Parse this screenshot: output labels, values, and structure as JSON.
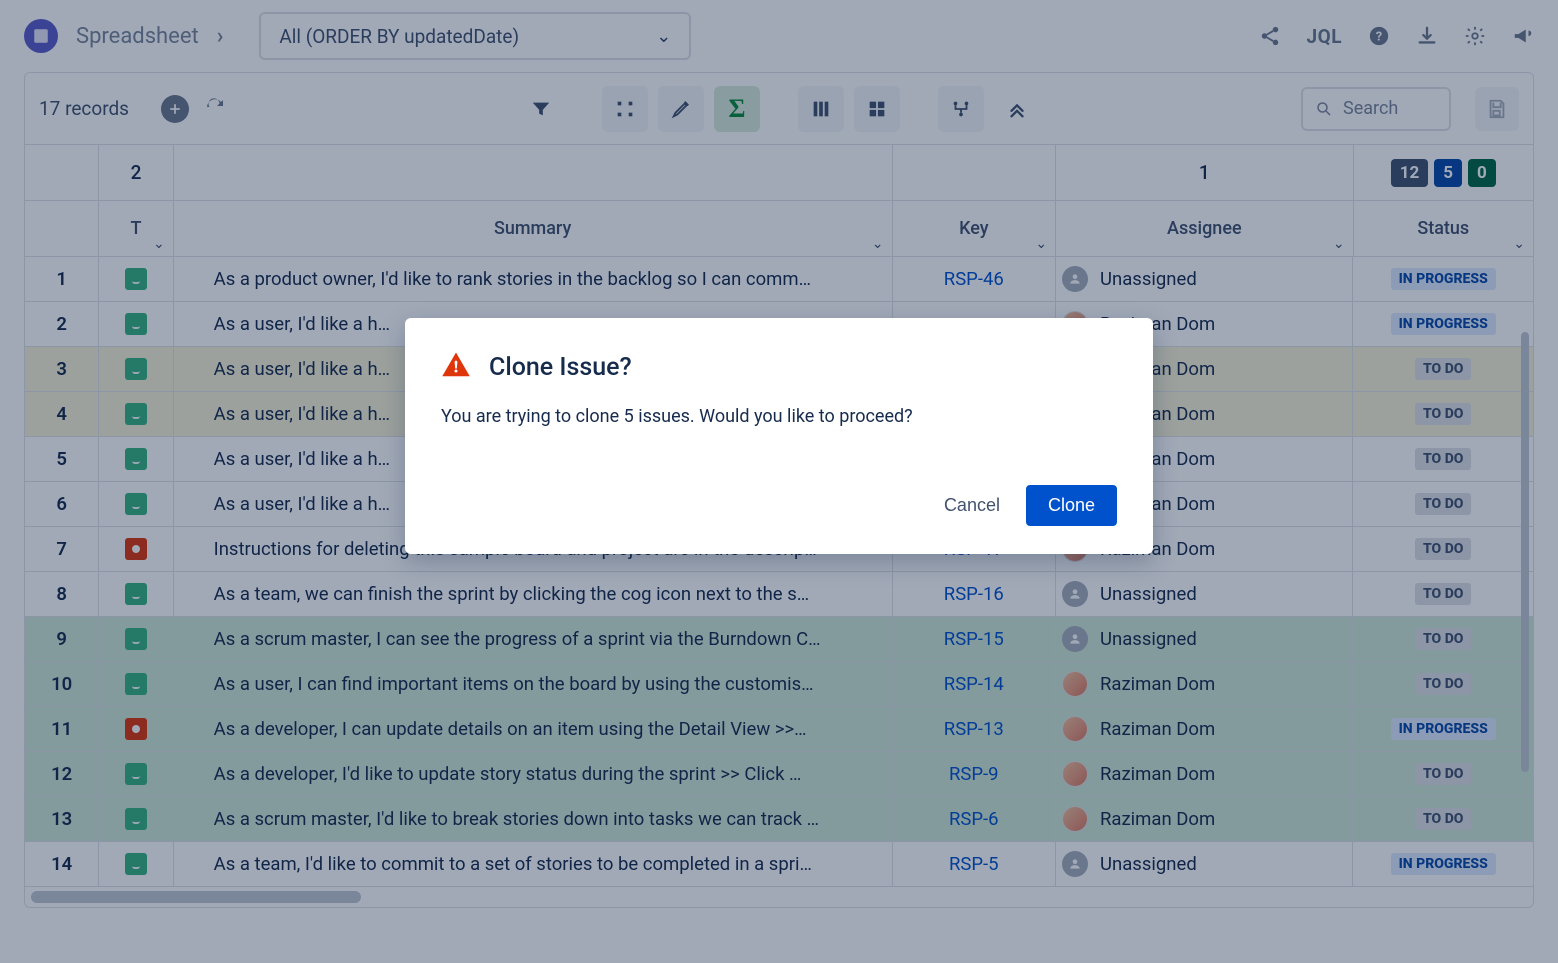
{
  "header": {
    "breadcrumb": "Spreadsheet",
    "filter_label": "All (ORDER BY updatedDate)",
    "jql_label": "JQL"
  },
  "toolbar": {
    "record_count": "17 records",
    "search_placeholder": "Search"
  },
  "summary": {
    "type_count": "2",
    "assignee_count": "1",
    "status_counts": {
      "todo": "12",
      "in_progress": "5",
      "done": "0"
    }
  },
  "columns": {
    "type": "T",
    "summary": "Summary",
    "key": "Key",
    "assignee": "Assignee",
    "status": "Status"
  },
  "status_labels": {
    "IN_PROGRESS": "IN PROGRESS",
    "TO_DO": "TO DO"
  },
  "assignees": {
    "unassigned": "Unassigned",
    "raziman": "Raziman Dom"
  },
  "rows": [
    {
      "n": "1",
      "type": "story",
      "summary": "As a product owner, I'd like to rank stories in the backlog so I can comm…",
      "key": "RSP-46",
      "assignee": "unassigned",
      "status": "IN_PROGRESS",
      "sel": false,
      "grn": false
    },
    {
      "n": "2",
      "type": "story",
      "summary": "As a user, I'd like a h…",
      "key": "",
      "assignee": "raziman",
      "status": "IN_PROGRESS",
      "sel": false,
      "grn": false
    },
    {
      "n": "3",
      "type": "story",
      "summary": "As a user, I'd like a h…",
      "key": "",
      "assignee": "raziman",
      "status": "TO_DO",
      "sel": true,
      "grn": false
    },
    {
      "n": "4",
      "type": "story",
      "summary": "As a user, I'd like a h…",
      "key": "",
      "assignee": "raziman",
      "status": "TO_DO",
      "sel": true,
      "grn": false
    },
    {
      "n": "5",
      "type": "story",
      "summary": "As a user, I'd like a h…",
      "key": "",
      "assignee": "raziman",
      "status": "TO_DO",
      "sel": false,
      "grn": false
    },
    {
      "n": "6",
      "type": "story",
      "summary": "As a user, I'd like a h…",
      "key": "",
      "assignee": "raziman",
      "status": "TO_DO",
      "sel": false,
      "grn": false
    },
    {
      "n": "7",
      "type": "bug",
      "summary": "Instructions for deleting this sample board and project are in the descrip…",
      "key": "RSP-17",
      "assignee": "raziman",
      "status": "TO_DO",
      "sel": false,
      "grn": false
    },
    {
      "n": "8",
      "type": "story",
      "summary": "As a team, we can finish the sprint by clicking the cog icon next to the s…",
      "key": "RSP-16",
      "assignee": "unassigned",
      "status": "TO_DO",
      "sel": false,
      "grn": false
    },
    {
      "n": "9",
      "type": "story",
      "summary": "As a scrum master, I can see the progress of a sprint via the Burndown C…",
      "key": "RSP-15",
      "assignee": "unassigned",
      "status": "TO_DO",
      "sel": false,
      "grn": true
    },
    {
      "n": "10",
      "type": "story",
      "summary": "As a user, I can find important items on the board by using the customis…",
      "key": "RSP-14",
      "assignee": "raziman",
      "status": "TO_DO",
      "sel": false,
      "grn": true
    },
    {
      "n": "11",
      "type": "bug",
      "summary": "As a developer, I can update details on an item using the Detail View >>…",
      "key": "RSP-13",
      "assignee": "raziman",
      "status": "IN_PROGRESS",
      "sel": false,
      "grn": true
    },
    {
      "n": "12",
      "type": "story",
      "summary": "As a developer, I'd like to update story status during the sprint >> Click …",
      "key": "RSP-9",
      "assignee": "raziman",
      "status": "TO_DO",
      "sel": false,
      "grn": true
    },
    {
      "n": "13",
      "type": "story",
      "summary": "As a scrum master, I'd like to break stories down into tasks we can track …",
      "key": "RSP-6",
      "assignee": "raziman",
      "status": "TO_DO",
      "sel": false,
      "grn": true
    },
    {
      "n": "14",
      "type": "story",
      "summary": "As a team, I'd like to commit to a set of stories to be completed in a spri…",
      "key": "RSP-5",
      "assignee": "unassigned",
      "status": "IN_PROGRESS",
      "sel": false,
      "grn": false
    }
  ],
  "modal": {
    "title": "Clone Issue?",
    "body": "You are trying to clone 5 issues. Would you like to proceed?",
    "cancel": "Cancel",
    "confirm": "Clone"
  }
}
